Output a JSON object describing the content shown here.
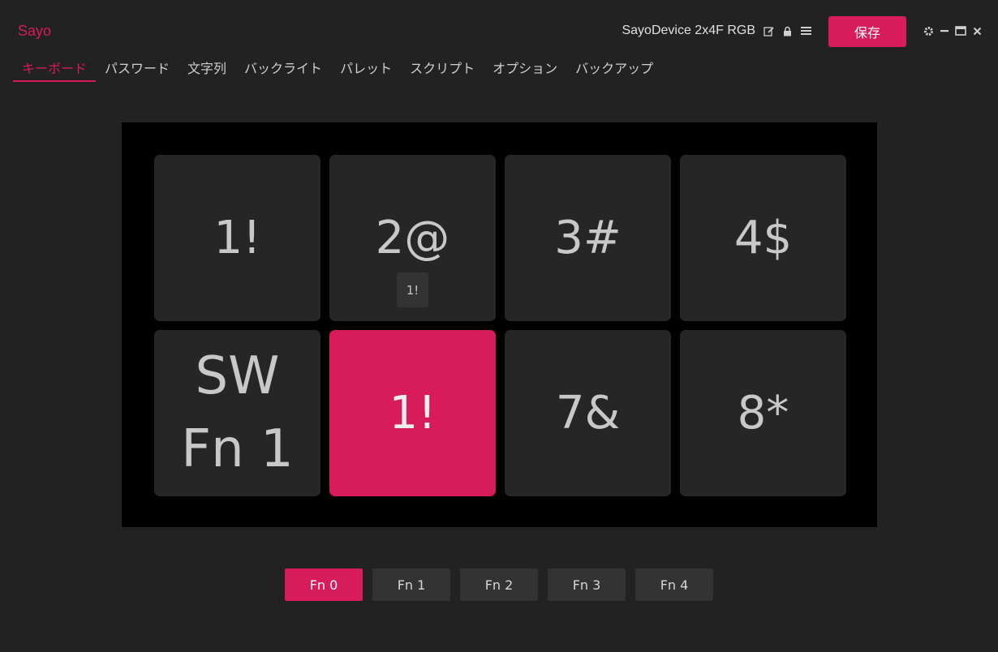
{
  "app": {
    "brand": "Sayo",
    "device_name": "SayoDevice 2x4F RGB",
    "save_label": "保存"
  },
  "colors": {
    "accent": "#d81b5a",
    "background": "#222222",
    "key": "#262626",
    "board": "#000000"
  },
  "tabs": [
    {
      "label": "キーボード",
      "active": true
    },
    {
      "label": "パスワード",
      "active": false
    },
    {
      "label": "文字列",
      "active": false
    },
    {
      "label": "バックライト",
      "active": false
    },
    {
      "label": "パレット",
      "active": false
    },
    {
      "label": "スクリプト",
      "active": false
    },
    {
      "label": "オプション",
      "active": false
    },
    {
      "label": "バックアップ",
      "active": false
    }
  ],
  "keys": [
    {
      "label": "1!"
    },
    {
      "label": "2@",
      "sub": "1!"
    },
    {
      "label": "3#"
    },
    {
      "label": "4$"
    },
    {
      "label": "SW\nFn 1"
    },
    {
      "label": "1!",
      "selected": true
    },
    {
      "label": "7&"
    },
    {
      "label": "8*"
    }
  ],
  "fn_layers": [
    {
      "label": "Fn 0",
      "active": true
    },
    {
      "label": "Fn 1",
      "active": false
    },
    {
      "label": "Fn 2",
      "active": false
    },
    {
      "label": "Fn 3",
      "active": false
    },
    {
      "label": "Fn 4",
      "active": false
    }
  ]
}
